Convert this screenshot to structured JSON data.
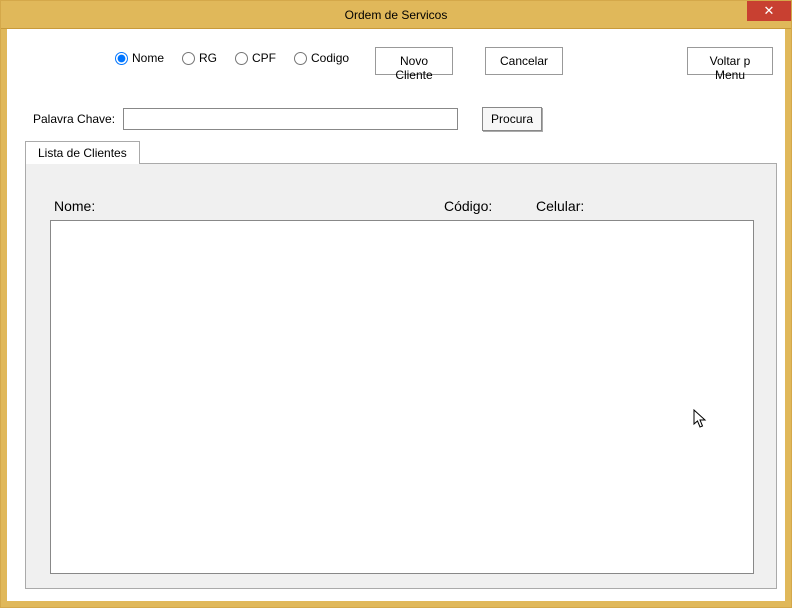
{
  "window": {
    "title": "Ordem de Servicos",
    "close_glyph": "✕"
  },
  "radios": {
    "nome": "Nome",
    "rg": "RG",
    "cpf": "CPF",
    "codigo": "Codigo"
  },
  "buttons": {
    "novo_cliente": "Novo Cliente",
    "cancelar": "Cancelar",
    "voltar_menu": "Voltar p Menu",
    "procura": "Procura"
  },
  "search": {
    "label": "Palavra Chave:",
    "value": ""
  },
  "tabs": {
    "lista_clientes": "Lista de Clientes"
  },
  "columns": {
    "nome": "Nome:",
    "codigo": "Código:",
    "celular": "Celular:"
  }
}
